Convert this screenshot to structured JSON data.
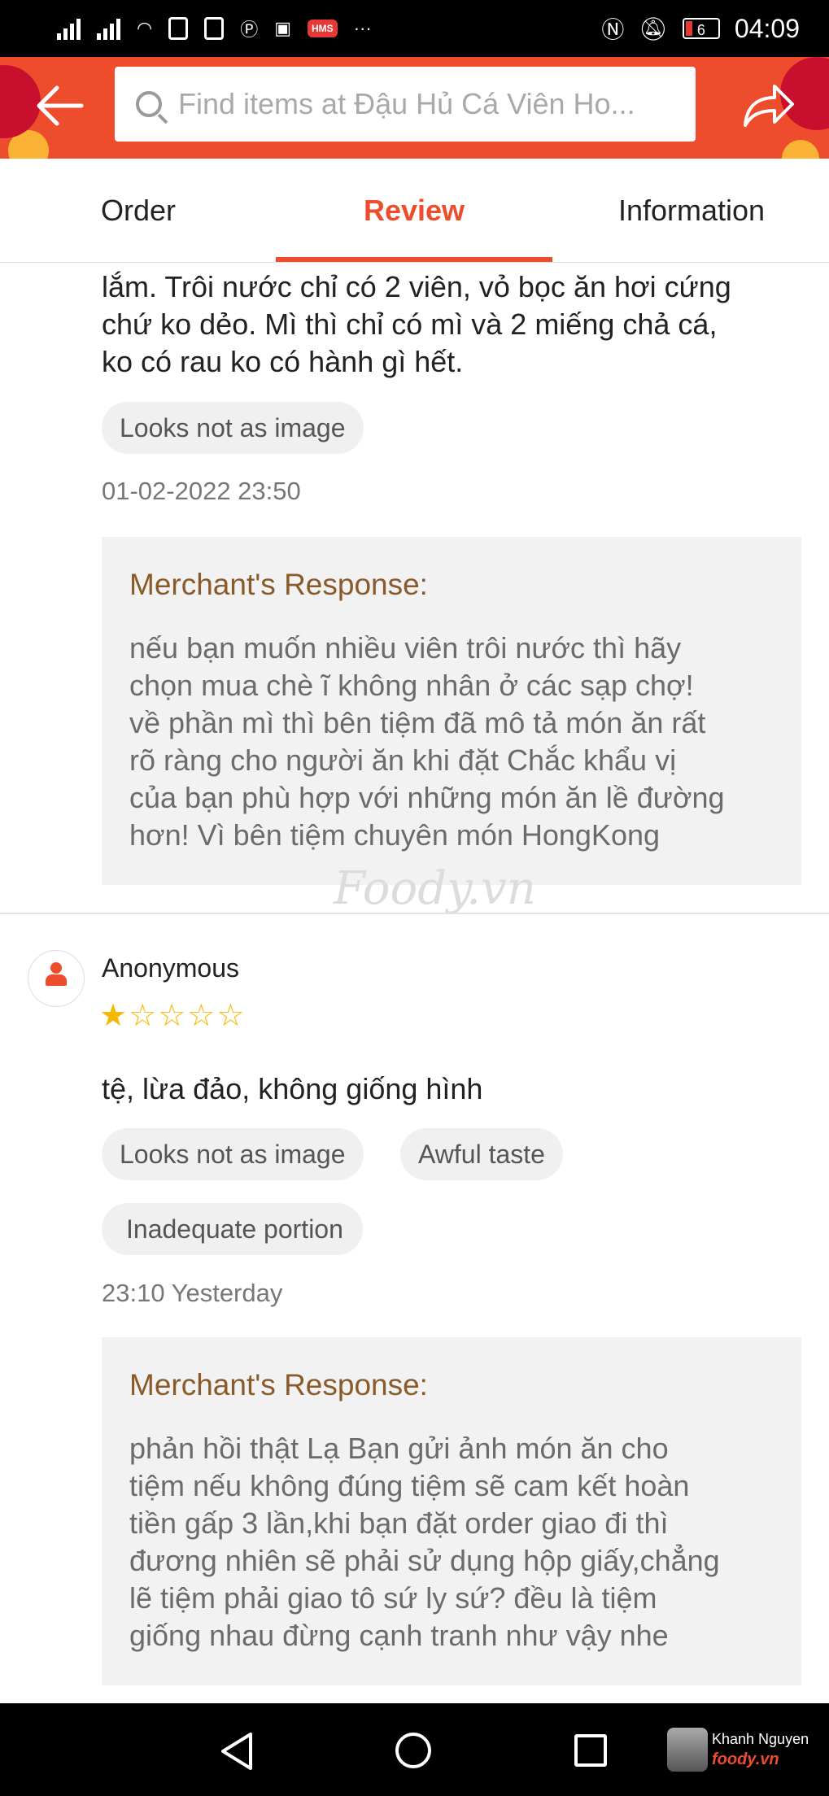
{
  "status_bar": {
    "time": "04:09",
    "battery": "6",
    "hms_badge": "HMS",
    "more": "···"
  },
  "header": {
    "search_placeholder": "Find items at Đậu Hủ Cá Viên Ho..."
  },
  "tabs": [
    {
      "label": "Order"
    },
    {
      "label": "Review",
      "active": true
    },
    {
      "label": "Information"
    }
  ],
  "reviews": [
    {
      "text_lines": [
        "lắm. Trôi nước chỉ có 2 viên, vỏ bọc ăn hơi cứng",
        "chứ ko dẻo. Mì thì chỉ có mì và 2 miếng chả cá,",
        "ko có rau ko có hành gì hết."
      ],
      "tags": [
        "Looks not as image"
      ],
      "date": "01-02-2022 23:50",
      "response": {
        "title": "Merchant's Response:",
        "lines": [
          "nếu bạn muốn nhiều viên trôi nước thì hãy",
          "chọn mua chè ĩ không nhân ở các sạp chợ!",
          "về phần mì thì bên tiệm đã mô tả món ăn rất",
          "rõ ràng cho người ăn khi đặt Chắc khẩu vị",
          "của bạn phù hợp với những món ăn lề đường",
          "hơn! Vì bên tiệm chuyên món HongKong"
        ]
      }
    },
    {
      "user": "Anonymous",
      "rating": 1,
      "rating_max": 5,
      "text": "tệ, lừa đảo, không giống hình",
      "tags": [
        "Looks not as image",
        "Awful taste",
        "Inadequate portion"
      ],
      "date": "23:10 Yesterday",
      "response": {
        "title": "Merchant's Response:",
        "lines": [
          "phản hồi thật Lạ Bạn gửi ảnh món ăn cho",
          "tiệm nếu không đúng tiệm sẽ cam kết hoàn",
          "tiền gấp 3 lần,khi bạn đặt order giao đi thì",
          "đương nhiên sẽ phải sử dụng hộp giấy,chẳng",
          "lẽ tiệm phải giao tô sứ ly sứ? đều là tiệm",
          "giống nhau đừng cạnh tranh như vậy nhe"
        ]
      }
    }
  ],
  "watermark": "Foody.vn",
  "nav_bar": {
    "user_name": "Khanh Nguyen",
    "brand": "foody.vn"
  },
  "colors": {
    "accent": "#ee4d2d",
    "response_title": "#8a5a2b",
    "star": "#f5b800"
  }
}
